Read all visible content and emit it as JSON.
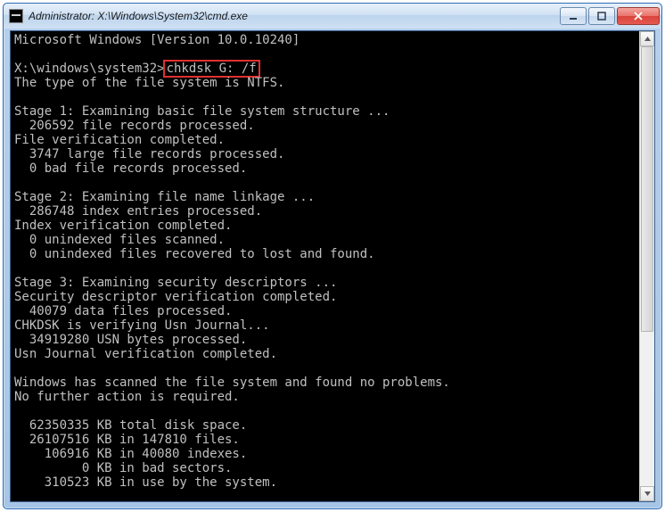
{
  "window": {
    "title": "Administrator: X:\\Windows\\System32\\cmd.exe"
  },
  "console": {
    "header": "Microsoft Windows [Version 10.0.10240]",
    "prompt": "X:\\windows\\system32>",
    "command": "chkdsk G: /f",
    "fs_line": "The type of the file system is NTFS.",
    "stage1_title": "Stage 1: Examining basic file system structure ...",
    "stage1_l1": "  206592 file records processed.",
    "stage1_l2": "File verification completed.",
    "stage1_l3": "  3747 large file records processed.",
    "stage1_l4": "  0 bad file records processed.",
    "stage2_title": "Stage 2: Examining file name linkage ...",
    "stage2_l1": "  286748 index entries processed.",
    "stage2_l2": "Index verification completed.",
    "stage2_l3": "  0 unindexed files scanned.",
    "stage2_l4": "  0 unindexed files recovered to lost and found.",
    "stage3_title": "Stage 3: Examining security descriptors ...",
    "stage3_l1": "Security descriptor verification completed.",
    "stage3_l2": "  40079 data files processed.",
    "stage3_l3": "CHKDSK is verifying Usn Journal...",
    "stage3_l4": "  34919280 USN bytes processed.",
    "stage3_l5": "Usn Journal verification completed.",
    "summary_l1": "Windows has scanned the file system and found no problems.",
    "summary_l2": "No further action is required.",
    "stats_l1": "  62350335 KB total disk space.",
    "stats_l2": "  26107516 KB in 147810 files.",
    "stats_l3": "    106916 KB in 40080 indexes.",
    "stats_l4": "         0 KB in bad sectors.",
    "stats_l5": "    310523 KB in use by the system."
  }
}
